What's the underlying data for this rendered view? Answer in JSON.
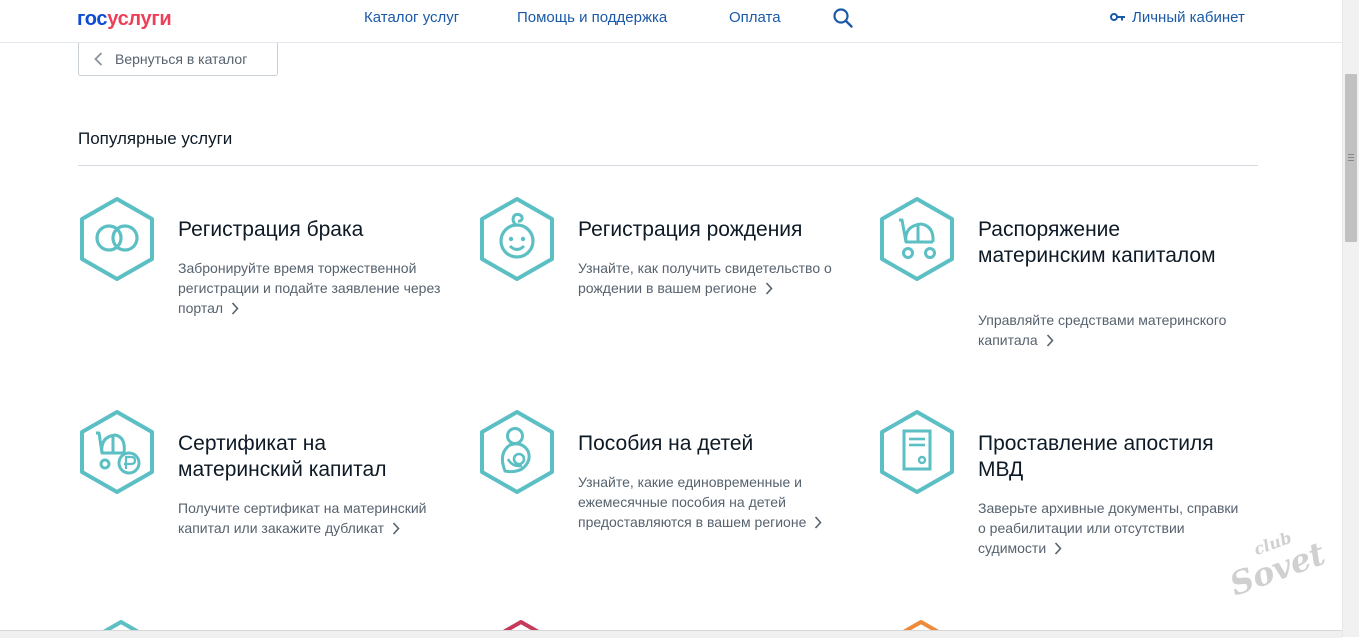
{
  "header": {
    "logo_part1": "гос",
    "logo_part2": "услуги",
    "nav": [
      "Каталог услуг",
      "Помощь и поддержка",
      "Оплата"
    ],
    "search_icon": "search-icon",
    "account_label": "Личный кабинет",
    "account_icon": "key-icon"
  },
  "back_button": {
    "label": "Вернуться в каталог",
    "icon": "chevron-left-icon"
  },
  "section": {
    "title": "Популярные услуги"
  },
  "cards": [
    {
      "title": "Регистрация брака",
      "desc": "Забронируйте время торжественной регистрации и подайте заявление через портал",
      "icon": "rings-icon"
    },
    {
      "title": "Регистрация рождения",
      "desc": "Узнайте, как получить свидетельство о рождении в вашем регионе",
      "icon": "baby-icon"
    },
    {
      "title": "Распоряжение материнским капиталом",
      "desc": "Управляйте средствами материнского капитала",
      "icon": "stroller-icon"
    },
    {
      "title": "Сертификат на материнский капитал",
      "desc": "Получите сертификат на материнский капитал или закажите дубликат",
      "icon": "stroller-ruble-icon"
    },
    {
      "title": "Пособия на детей",
      "desc": "Узнайте, какие единовременные и ежемесячные пособия на детей предоставляются в вашем регионе",
      "icon": "mother-child-icon"
    },
    {
      "title": "Проставление апостиля МВД",
      "desc": "Заверьте архивные документы, справки о реабилитации или отсутствии судимости",
      "icon": "document-icon"
    }
  ],
  "colors": {
    "accent_teal": "#5bbfc4",
    "link_blue": "#1a5aa8",
    "logo_blue": "#0d4cd3",
    "logo_red": "#ee3f58"
  },
  "watermark": {
    "line1": "club",
    "line2": "Sovet"
  }
}
